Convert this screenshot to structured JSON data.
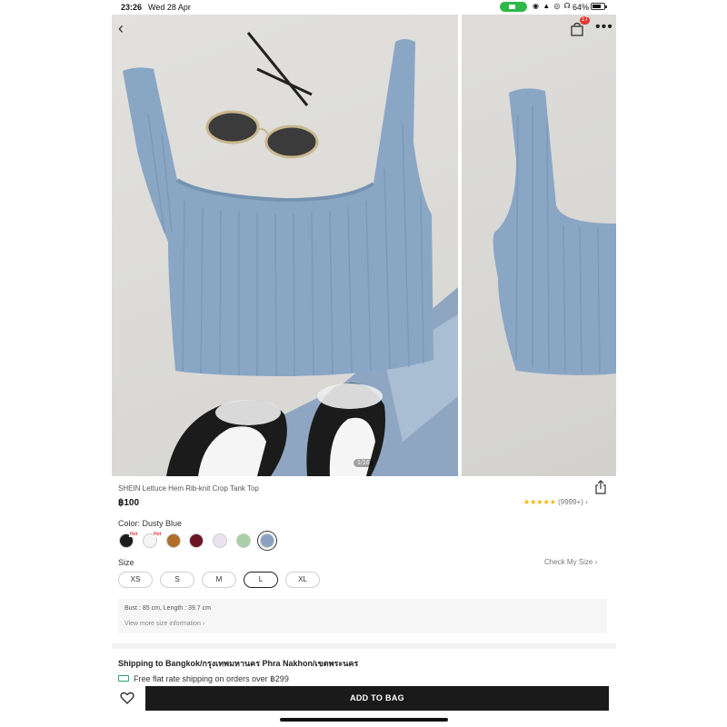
{
  "status_bar": {
    "time": "23:26",
    "date": "Wed 28 Apr",
    "battery": "64%"
  },
  "gallery": {
    "image_counter": "1/16",
    "cart_count": "17"
  },
  "product": {
    "title": "SHEIN Lettuce Hem Rib-knit Crop Tank Top",
    "price": "฿100",
    "rating_stars": "★★★★★",
    "rating_count": "(9999+)"
  },
  "color": {
    "label": "Color: Dusty Blue",
    "hot_label": "Hot",
    "swatches": [
      "#1c1c1c",
      "#f4f4f4",
      "#b06f2a",
      "#6b1525",
      "#e9e3f0",
      "#a8cfa6",
      "#8aa1c1"
    ]
  },
  "size": {
    "label": "Size",
    "check_my_size": "Check My Size",
    "options": [
      "XS",
      "S",
      "M",
      "L",
      "XL"
    ],
    "selected": "L",
    "details": "Bust : 85 cm,   Length : 39.7 cm",
    "view_more": "View more size information"
  },
  "shipping": {
    "title": "Shipping to Bangkok/กรุงเทพมหานคร Phra Nakhon/เขตพระนคร",
    "line": "Free flat rate shipping on orders over ฿299"
  },
  "actions": {
    "add_to_bag": "ADD TO BAG"
  }
}
